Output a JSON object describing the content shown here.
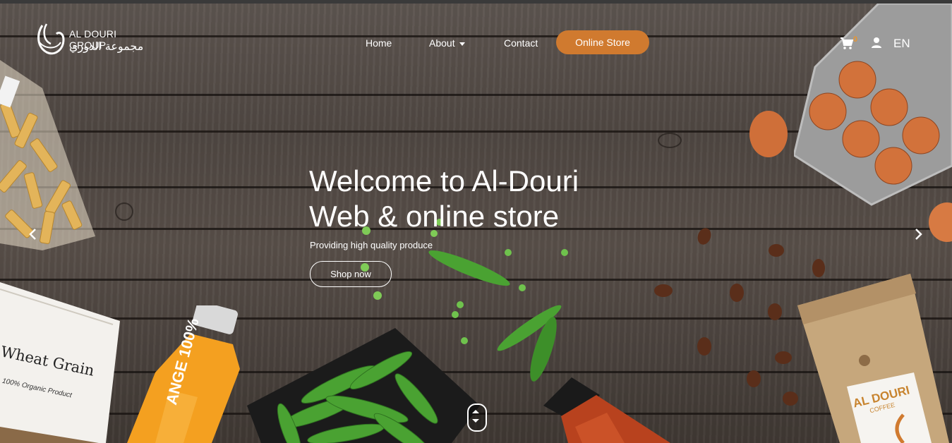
{
  "brand": {
    "name_en": "AL DOURI GROUP",
    "name_ar": "مجموعة الدوري"
  },
  "nav": {
    "items": [
      {
        "label": "Home"
      },
      {
        "label": "About"
      },
      {
        "label": "Contact"
      }
    ],
    "online_store": "Online Store",
    "cart_count": "0",
    "language": "EN"
  },
  "hero": {
    "title_line1": "Welcome to Al-Douri",
    "title_line2": "Web & online store",
    "subtitle": "Providing high quality produce",
    "cta": "Shop now"
  },
  "props": {
    "flour_bag_text1": "Wheat Grain",
    "flour_bag_text2": "100% Organic Product",
    "juice_text": "ANGE  100%",
    "coffee_bag_text1": "AL DOURI",
    "coffee_bag_text2": "COFFEE"
  },
  "colors": {
    "accent": "#d07a2f",
    "cart_badge": "#e8952f"
  }
}
